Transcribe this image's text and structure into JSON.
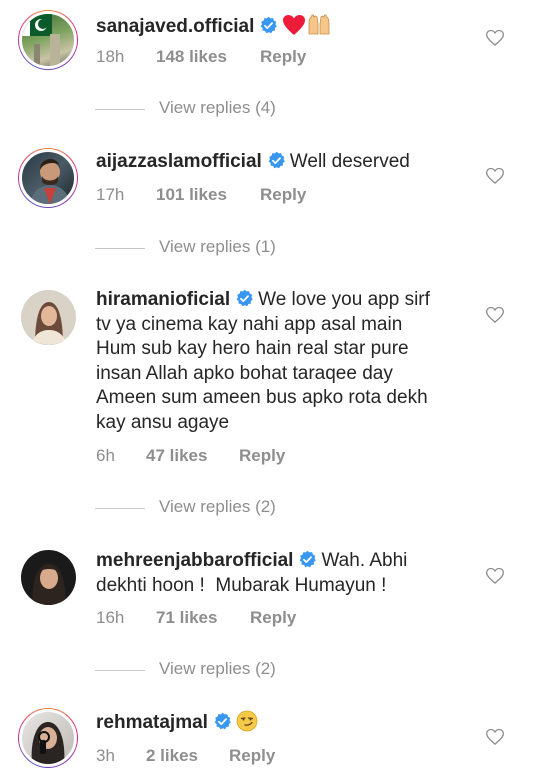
{
  "comments": [
    {
      "username": "sanajaved.official",
      "text": "",
      "time": "18h",
      "likes": "148 likes",
      "reply": "Reply",
      "emojis": [
        "heart-emoji",
        "raising-hands-emoji"
      ],
      "view_replies": "View replies (4)"
    },
    {
      "username": "aijazzaslamofficial",
      "text": "Well deserved",
      "time": "17h",
      "likes": "101 likes",
      "reply": "Reply",
      "view_replies": "View replies (1)"
    },
    {
      "username": "hiramanioficial",
      "text_lines": [
        "We love you app sirf",
        "tv ya cinema kay nahi app asal main",
        "Hum sub kay hero hain real star pure",
        "insan Allah apko bohat taraqee day",
        "Ameen sum ameen bus apko rota dekh",
        "kay ansu agaye"
      ],
      "time": "6h",
      "likes": "47 likes",
      "reply": "Reply",
      "view_replies": "View replies (2)"
    },
    {
      "username": "mehreenjabbarofficial",
      "text_lines": [
        "Wah. Abhi",
        "dekhti hoon !  Mubarak Humayun !"
      ],
      "time": "16h",
      "likes": "71 likes",
      "reply": "Reply",
      "view_replies": "View replies (2)"
    },
    {
      "username": "rehmatajmal",
      "text": "",
      "time": "3h",
      "likes": "2 likes",
      "reply": "Reply",
      "emojis": [
        "smirking-face-emoji"
      ]
    }
  ],
  "colors": {
    "text": "#262626",
    "meta": "#8e8e8e",
    "verified": "#3897f0",
    "heart_emoji": "#ed1c3b"
  }
}
